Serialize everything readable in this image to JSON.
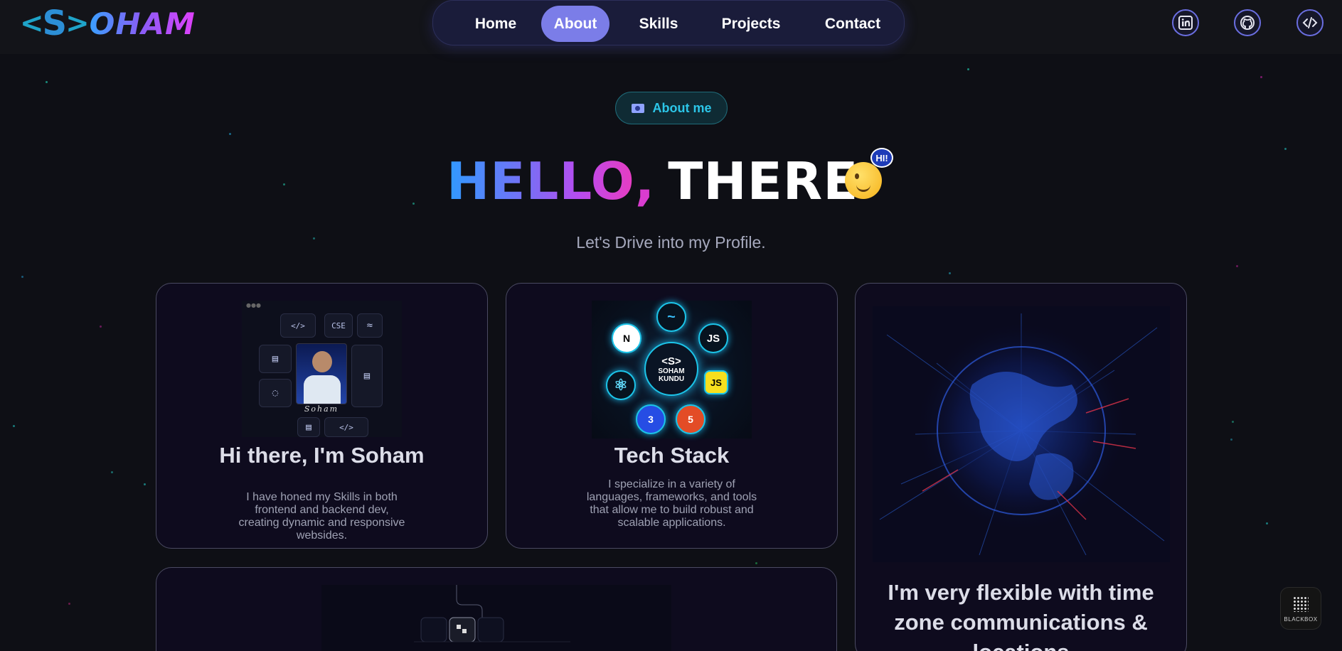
{
  "header": {
    "logo": {
      "bracket_left": "<",
      "letter": "S",
      "bracket_right": ">",
      "text": "OHAM"
    },
    "nav": {
      "items": [
        {
          "label": "Home",
          "active": false
        },
        {
          "label": "About",
          "active": true
        },
        {
          "label": "Skills",
          "active": false
        },
        {
          "label": "Projects",
          "active": false
        },
        {
          "label": "Contact",
          "active": false
        }
      ]
    },
    "socials": [
      {
        "icon": "linkedin-icon"
      },
      {
        "icon": "github-icon"
      },
      {
        "icon": "code-icon"
      }
    ]
  },
  "hero": {
    "badge_label": "About me",
    "title_grad": "HELLO",
    "title_comma": ",",
    "title_rest": "THERE",
    "emoji_bubble": "HI!",
    "subtitle": "Let's Drive into my Profile."
  },
  "cards": {
    "intro": {
      "title": "Hi there, I'm Soham",
      "description": "I have honed my Skills in both frontend and backend dev, creating dynamic and responsive websides.",
      "tiles": {
        "code1": "</>",
        "cse": "CSE",
        "code2": "</>",
        "name_tag": "Soham"
      }
    },
    "tech": {
      "title": "Tech Stack",
      "description": "I specialize in a variety of languages, frameworks, and tools that allow me to build robust and scalable applications.",
      "center_logo": "<S>",
      "center_name": "SOHAM KUNDU",
      "nodes": [
        "N",
        "JS",
        "JS",
        "5",
        "3",
        "⚛",
        "~"
      ]
    },
    "globe": {
      "title": "I'm very flexible with time zone communications & locations"
    }
  },
  "widget": {
    "label": "BLACKBOX"
  },
  "colors": {
    "background": "#0e0f15",
    "nav_bg": "#1a1c3a",
    "nav_active": "#7b7de8",
    "accent_cyan": "#2cc6e8",
    "card_border": "#4a4a62"
  }
}
